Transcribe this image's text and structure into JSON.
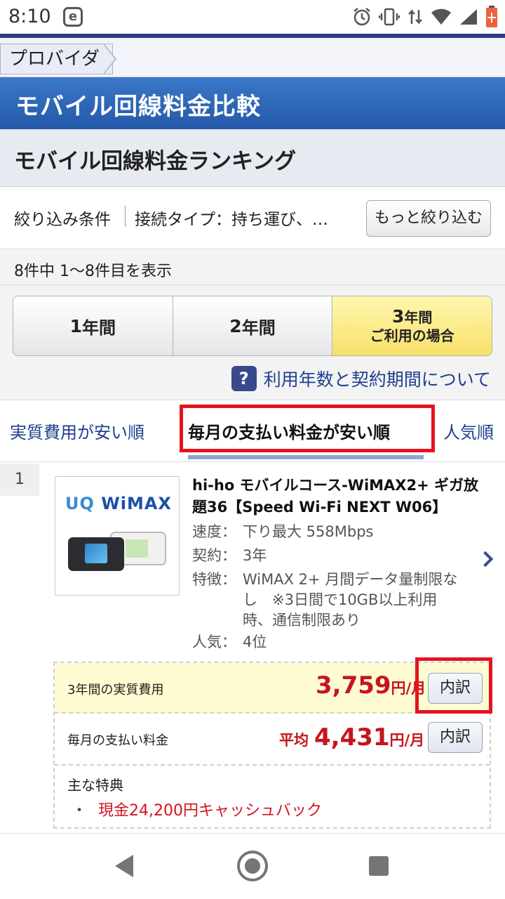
{
  "status": {
    "time": "8:10",
    "app_icon": "e"
  },
  "breadcrumb": {
    "label": "プロバイダ"
  },
  "header": {
    "title": "モバイル回線料金比較"
  },
  "ranking": {
    "title": "モバイル回線料金ランキング"
  },
  "filter": {
    "label": "絞り込み条件",
    "condition": "接続タイプ：持ち運び、…",
    "more_button": "もっと絞り込む"
  },
  "results": {
    "count_text": "8件中 1〜8件目を表示"
  },
  "period": {
    "opt1_num": "1",
    "opt1_unit": "年間",
    "opt2_num": "2",
    "opt2_unit": "年間",
    "opt3_line1_num": "3",
    "opt3_line1_unit": "年間",
    "opt3_line2": "ご利用の場合",
    "selected": "3年間"
  },
  "help": {
    "icon": "?",
    "text": "利用年数と契約期間について"
  },
  "sort_tabs": {
    "tab1": "実質費用が安い順",
    "tab2": "毎月の支払い料金が安い順",
    "tab3": "人気順"
  },
  "item": {
    "rank": "1",
    "logo_uq": "UQ",
    "logo_wimax": "WiMAX",
    "title": "hi-ho モバイルコース-WiMAX2+ ギガ放題36【Speed Wi-Fi NEXT W06】",
    "speed_label": "速度：",
    "speed": "下り最大 558Mbps",
    "contract_label": "契約：",
    "contract": "3年",
    "feature_label": "特徴：",
    "feature_l1": "WiMAX 2+ 月間データ量制限な",
    "feature_l2": "し　※3日間で10GB以上利用",
    "feature_l3": "時、通信制限あり",
    "popularity_label": "人気：",
    "popularity": "4位",
    "effective_cost_label": "3年間の実質費用",
    "effective_cost_value": "3,759",
    "effective_cost_unit": "円/月",
    "monthly_label": "毎月の支払い料金",
    "monthly_prefix": "平均",
    "monthly_value": "4,431",
    "monthly_unit": "円/月",
    "breakdown_button": "内訳",
    "benefits_title": "主な特典",
    "benefit_bullet": "・",
    "benefit_1": "現金24,200円キャッシュバック"
  },
  "colors": {
    "accent": "#2458a8",
    "price_red": "#c6151e",
    "highlight_box": "#e3141f",
    "selected_period": "#f7e06a"
  }
}
